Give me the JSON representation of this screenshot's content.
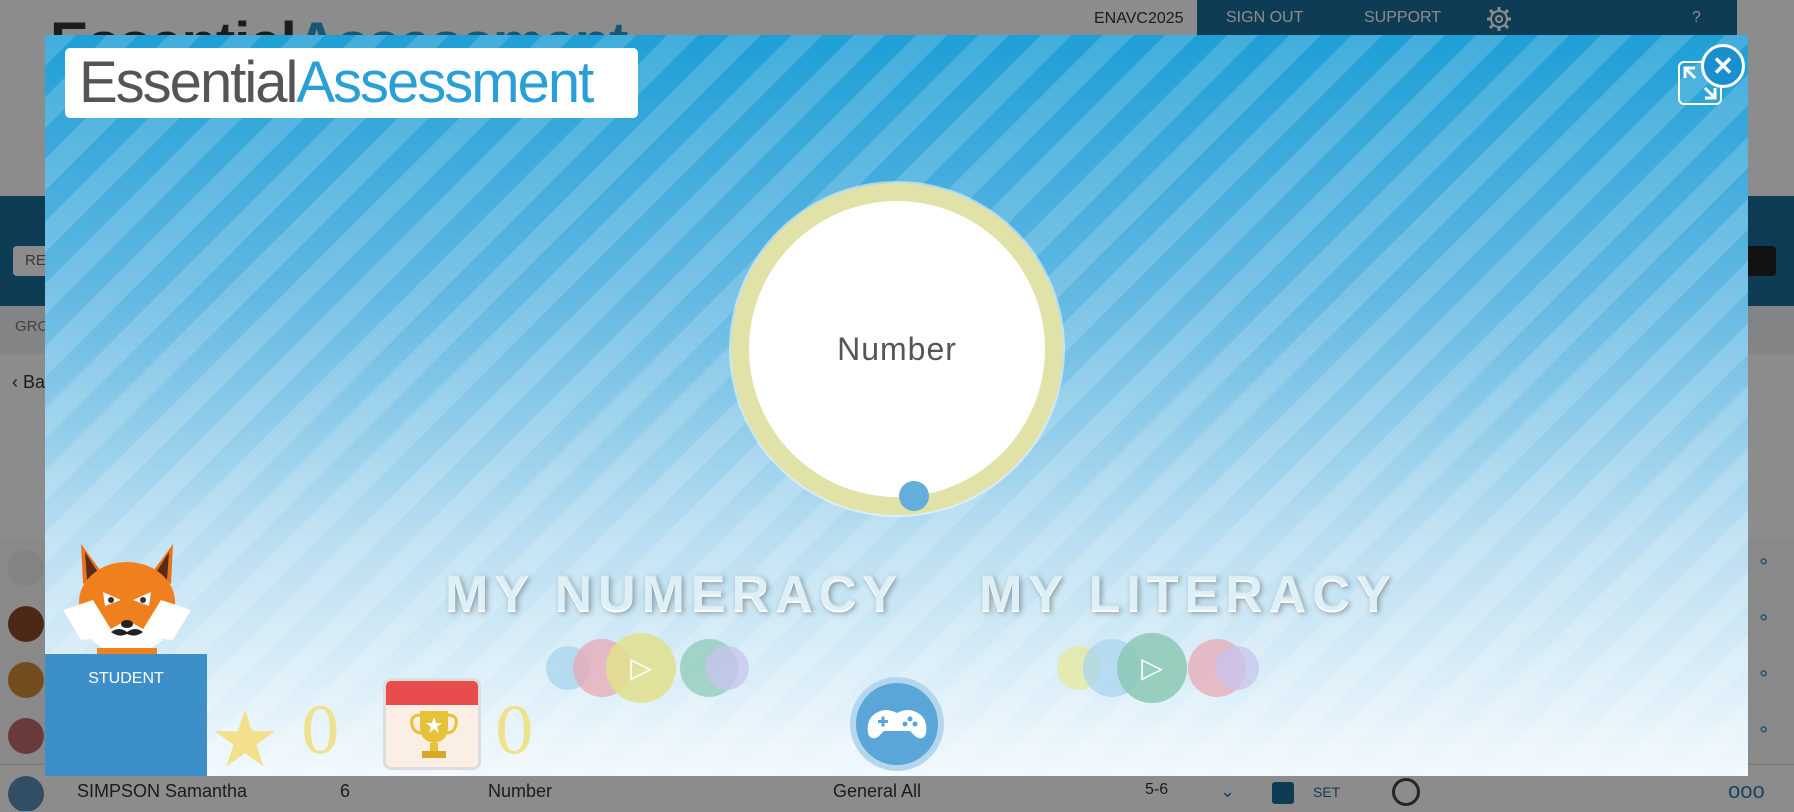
{
  "background": {
    "logo": {
      "part1": "Essential",
      "part2": "Assessment"
    },
    "school_code": "ENAVC2025",
    "nav": {
      "sign_out": "SIGN OUT",
      "support": "SUPPORT",
      "help": "?"
    },
    "filter_stub": "RE",
    "group_stub": "GRO",
    "back_stub": "Ba",
    "last_row": {
      "name": "SIMPSON Samantha",
      "year": "6",
      "strand": "Number",
      "set": "General All",
      "level": "5-6",
      "set_label": "SET"
    }
  },
  "modal": {
    "logo": {
      "part1": "Essential",
      "part2": "Assessment"
    },
    "close_symbol": "✕",
    "circle_label": "Number",
    "numeracy_title": "MY NUMERACY",
    "literacy_title": "MY LITERACY",
    "student_label": "STUDENT",
    "stars_count": "0",
    "trophies_count": "0",
    "icons": {
      "close": "close-icon",
      "expand": "expand-icon",
      "star": "star-icon",
      "trophy": "trophy-icon",
      "gamepad": "gamepad-icon",
      "play": "play-icon",
      "mascot": "fox-mascot"
    },
    "colors": {
      "brand_blue": "#2a9fd6",
      "ring_yellow": "#e1e2a8",
      "student_panel": "#3d8fc9",
      "trophy_red": "#e84c4c"
    }
  }
}
